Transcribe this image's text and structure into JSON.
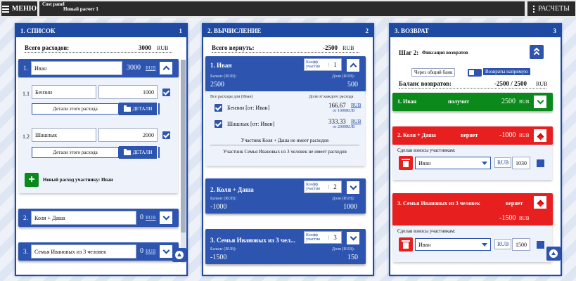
{
  "topbar": {
    "menu": "МЕНЮ",
    "app": "Cost panel",
    "title": "Новый расчет 1",
    "calcs": "РАСЧЕТЫ"
  },
  "list": {
    "header": "1. СПИСОК",
    "num": "1",
    "total_label": "Всего расходов:",
    "total_value": "3000",
    "currency": "RUB",
    "p1": {
      "idx": "1.",
      "name": "Иван",
      "sum": "3000",
      "cur": "RUB",
      "e1": {
        "idx": "1.1",
        "name": "Бензин",
        "value": "1000",
        "details": "Детали этого расхода",
        "btn": "ДЕТАЛИ"
      },
      "e2": {
        "idx": "1.2",
        "name": "Шашлык",
        "value": "2000",
        "details": "Детали этого расхода",
        "btn": "ДЕТАЛИ"
      },
      "new": "Новый расход участнику: Иван"
    },
    "p2": {
      "idx": "2.",
      "name": "Коля + Даша",
      "sum": "0",
      "cur": "RUB"
    },
    "p3": {
      "idx": "3.",
      "name": "Семья Ивановых из 3 человек",
      "sum": "0",
      "cur": "RUB"
    }
  },
  "calc": {
    "header": "2. ВЫЧИСЛЕНИЕ",
    "num": "2",
    "total_label": "Всего вернуть:",
    "total_value": "-2500",
    "currency": "RUB",
    "p1": {
      "name": "1. Иван",
      "coef": "Коэфф участия",
      "coef_v": "1",
      "bal_label": "Баланс (RUB):",
      "bal": "2500",
      "share_label": "Доля (RUB):",
      "share": "500",
      "col1": "Все расходы для (Иван)",
      "col2": "Доля от каждого расхода",
      "r1": {
        "text": "Бензин [от: Иван]",
        "v": "166.67",
        "s": "RUB",
        "sub": "от 1000RUB"
      },
      "r2": {
        "text": "Шашлык [от: Иван]",
        "v": "333.33",
        "s": "RUB",
        "sub": "от 2000RUB"
      },
      "n1": "Участник Коля + Даша не имеет расходов",
      "n2": "Участник Семья Ивановых из 3 человек не имеет расходов"
    },
    "p2": {
      "name": "2. Коля + Даша",
      "coef": "Коэфф участия",
      "coef_v": "2",
      "bal_label": "Баланс (RUB):",
      "bal": "-1000",
      "share_label": "Доля (RUB):",
      "share": "1000"
    },
    "p3": {
      "name": "3. Семья Ивановых из 3 чел...",
      "coef": "Коэфф участия",
      "coef_v": "3",
      "bal_label": "Баланс (RUB):",
      "bal": "-1500",
      "share_label": "Доля (RUB):",
      "share": "150"
    }
  },
  "ret": {
    "header": "3. ВОЗВРАТ",
    "num": "3",
    "step": "Шаг 2:",
    "step_text": "Фиксация возвратов",
    "opt1": "Через общий банк",
    "opt2": "Возвраты напрямую",
    "bal_label": "Баланс возвратов:",
    "bal_value": "-2500 / 2500",
    "currency": "RUB",
    "p1": {
      "name": "1. Иван",
      "verb": "получит",
      "amount": "2500",
      "cur": "RUB"
    },
    "p2": {
      "name": "2. Коля + Даша",
      "verb": "вернет",
      "amount": "-1000",
      "cur": "RUB",
      "label": "Сделав взносы участникам:",
      "sel": "Иван",
      "cur2": "RUB",
      "val": "1030"
    },
    "p3": {
      "name": "3. Семья Ивановых из 3 человек",
      "verb": "вернет",
      "amount": "-1500",
      "cur": "RUB",
      "label": "Сделав взносы участникам:",
      "sel": "Иван",
      "cur2": "RUB",
      "val": "1500"
    }
  }
}
